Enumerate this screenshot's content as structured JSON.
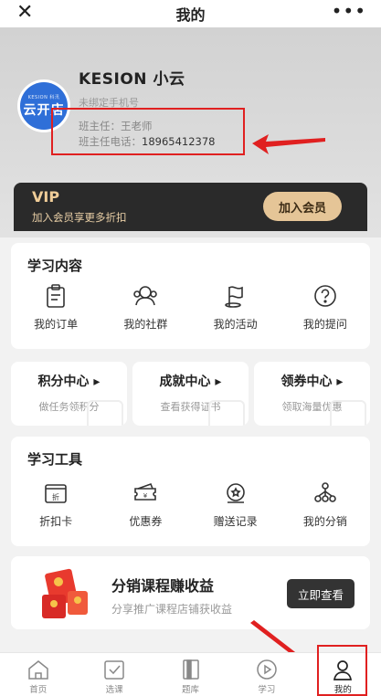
{
  "topbar": {
    "title": "我的",
    "close_label": "✕",
    "more_label": "•••"
  },
  "profile": {
    "logo_small": "KESION 科汛",
    "logo_main": "云开店",
    "name": "KESION 小云",
    "bind_phone": "未绑定手机号",
    "teacher": "班主任：王老师",
    "teacher_phone_label": "班主任电话：",
    "teacher_phone": "18965412378"
  },
  "vip": {
    "title": "VIP",
    "subtitle": "加入会员享更多折扣",
    "button": "加入会员"
  },
  "learn": {
    "title": "学习内容",
    "items": [
      {
        "label": "我的订单",
        "icon": "clipboard-icon"
      },
      {
        "label": "我的社群",
        "icon": "group-icon"
      },
      {
        "label": "我的活动",
        "icon": "flag-icon"
      },
      {
        "label": "我的提问",
        "icon": "question-icon"
      }
    ]
  },
  "minis": [
    {
      "title": "积分中心 ▸",
      "sub": "做任务领积分"
    },
    {
      "title": "成就中心 ▸",
      "sub": "查看获得证书"
    },
    {
      "title": "领券中心 ▸",
      "sub": "领取海量优惠"
    }
  ],
  "tools": {
    "title": "学习工具",
    "items": [
      {
        "label": "折扣卡",
        "icon": "discount-card-icon",
        "glyph": "折"
      },
      {
        "label": "优惠券",
        "icon": "coupon-icon",
        "glyph": "¥"
      },
      {
        "label": "赠送记录",
        "icon": "gift-record-icon"
      },
      {
        "label": "我的分销",
        "icon": "network-icon"
      }
    ]
  },
  "distribution": {
    "title": "分销课程赚收益",
    "subtitle": "分享推广课程店铺获收益",
    "button": "立即查看"
  },
  "tabs": [
    {
      "label": "首页",
      "icon": "home-icon"
    },
    {
      "label": "选课",
      "icon": "course-select-icon"
    },
    {
      "label": "题库",
      "icon": "question-bank-icon"
    },
    {
      "label": "学习",
      "icon": "play-icon"
    },
    {
      "label": "我的",
      "icon": "user-icon"
    }
  ],
  "colors": {
    "annotation_red": "#e02020",
    "vip_gold": "#e5c597",
    "avatar_blue": "#2f6fd8"
  }
}
